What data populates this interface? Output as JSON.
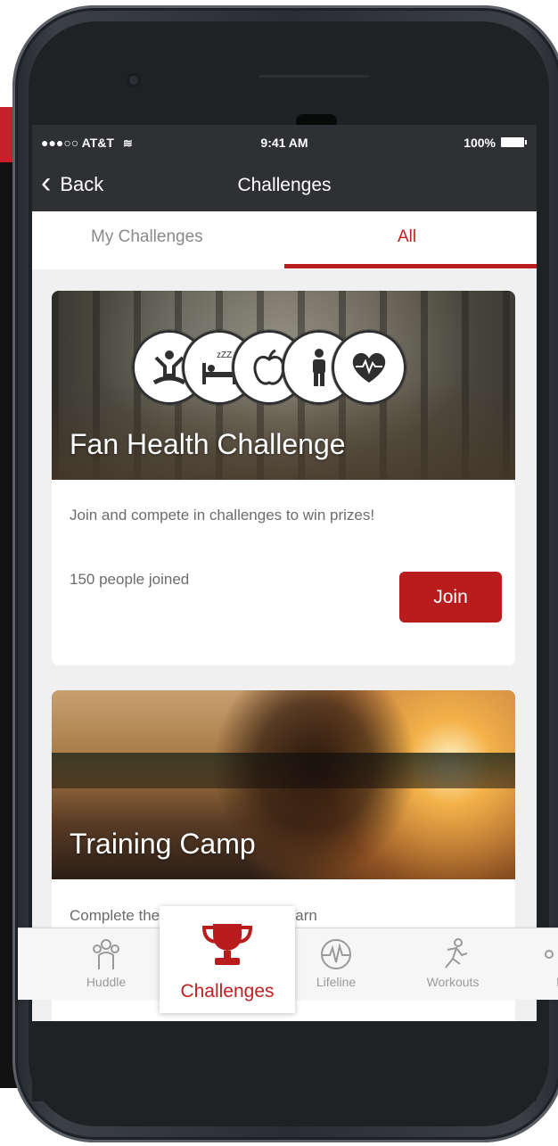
{
  "status_bar": {
    "carrier": "●●●○○ AT&T",
    "time": "9:41 AM",
    "battery": "100%"
  },
  "nav": {
    "back_label": "Back",
    "title": "Challenges"
  },
  "tabs": [
    {
      "label": "My Challenges",
      "active": false
    },
    {
      "label": "All",
      "active": true
    }
  ],
  "cards": [
    {
      "title": "Fan Health Challenge",
      "description": "Join and compete in challenges to win prizes!",
      "participants": "150 people joined",
      "button_label": "Join",
      "badge_icons": [
        "yoga-icon",
        "sleep-icon",
        "apple-icon",
        "person-icon",
        "heart-rate-icon"
      ]
    },
    {
      "title": "Training Camp",
      "description": "Complete the Training Camp to learn"
    }
  ],
  "tab_bar": [
    {
      "label": "Huddle",
      "icon": "huddle-icon",
      "active": false
    },
    {
      "label": "Challenges",
      "icon": "trophy-icon",
      "active": true
    },
    {
      "label": "Lifeline",
      "icon": "lifeline-icon",
      "active": false
    },
    {
      "label": "Workouts",
      "icon": "runner-icon",
      "active": false
    },
    {
      "label": "M",
      "icon": "more-icon",
      "active": false
    }
  ],
  "colors": {
    "accent": "#b81c1c",
    "nav_bg": "#2e3033",
    "screen_bg": "#f0f0f0"
  }
}
